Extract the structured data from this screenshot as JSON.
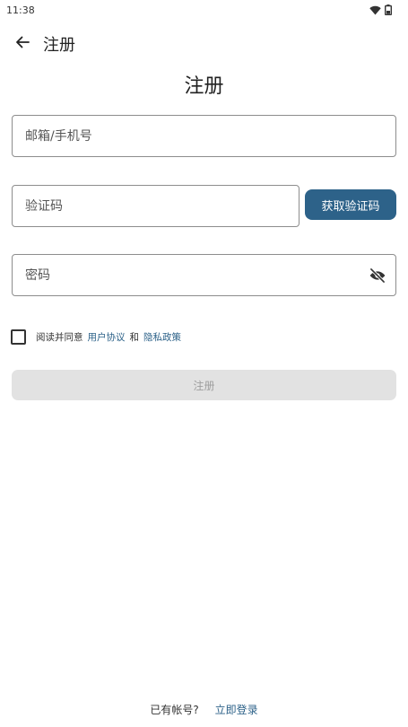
{
  "status_bar": {
    "time": "11:38"
  },
  "app_bar": {
    "title": "注册"
  },
  "page": {
    "title": "注册"
  },
  "form": {
    "email": {
      "placeholder": "邮箱/手机号",
      "value": ""
    },
    "code": {
      "placeholder": "验证码",
      "value": ""
    },
    "get_code_label": "获取验证码",
    "password": {
      "placeholder": "密码",
      "value": ""
    }
  },
  "agreement": {
    "prefix": "阅读并同意",
    "user_agreement": "用户协议",
    "and": "和",
    "privacy_policy": "隐私政策",
    "checked": false
  },
  "register_label": "注册",
  "footer": {
    "question": "已有帐号?",
    "login_link": "立即登录"
  },
  "colors": {
    "accent": "#2d6289",
    "disabled_button": "#e2e2e2",
    "field_border": "#8d8d8d"
  },
  "icons": {
    "back": "arrow-left-icon",
    "password_toggle": "eye-off-icon",
    "wifi": "wifi-icon",
    "battery": "battery-icon"
  }
}
